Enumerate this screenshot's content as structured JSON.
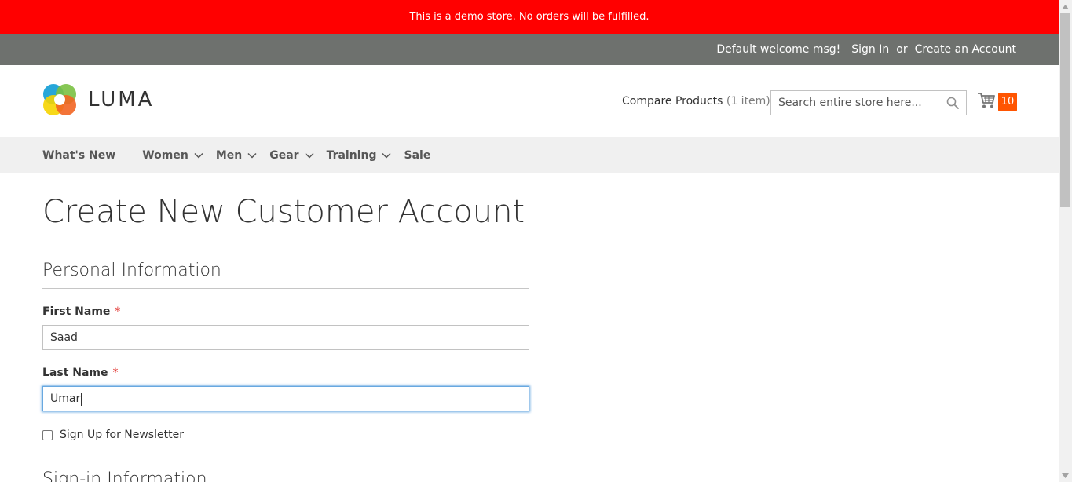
{
  "demo_banner": {
    "text": "This is a demo store. No orders will be fulfilled."
  },
  "panel": {
    "welcome": "Default welcome msg!",
    "sign_in": "Sign In",
    "or": "or",
    "create_account": "Create an Account"
  },
  "header": {
    "logo_text": "LUMA",
    "compare_label": "Compare Products",
    "compare_count": "(1 item)",
    "search_placeholder": "Search entire store here...",
    "cart_count": "10"
  },
  "nav": {
    "items": [
      {
        "label": "What's New",
        "has_dropdown": false
      },
      {
        "label": "Women",
        "has_dropdown": true
      },
      {
        "label": "Men",
        "has_dropdown": true
      },
      {
        "label": "Gear",
        "has_dropdown": true
      },
      {
        "label": "Training",
        "has_dropdown": true
      },
      {
        "label": "Sale",
        "has_dropdown": false
      }
    ]
  },
  "main": {
    "page_title": "Create New Customer Account",
    "personal_info": {
      "legend": "Personal Information",
      "first_name_label": "First Name",
      "first_name_value": "Saad",
      "last_name_label": "Last Name",
      "last_name_value": "Umar",
      "required_mark": "*",
      "newsletter_label": "Sign Up for Newsletter",
      "newsletter_checked": false
    },
    "next_legend": "Sign-in Information"
  },
  "colors": {
    "demo_banner_bg": "#ff0000",
    "panel_bg": "#6e716e",
    "nav_bg": "#f0f0f0",
    "cart_counter_bg": "#ff5501",
    "required": "#e02b27",
    "focus": "#68a8e0"
  },
  "icons": {
    "search": "search-icon",
    "cart": "cart-icon",
    "chevron": "chevron-down-icon",
    "logo": "luma-logo-icon"
  }
}
